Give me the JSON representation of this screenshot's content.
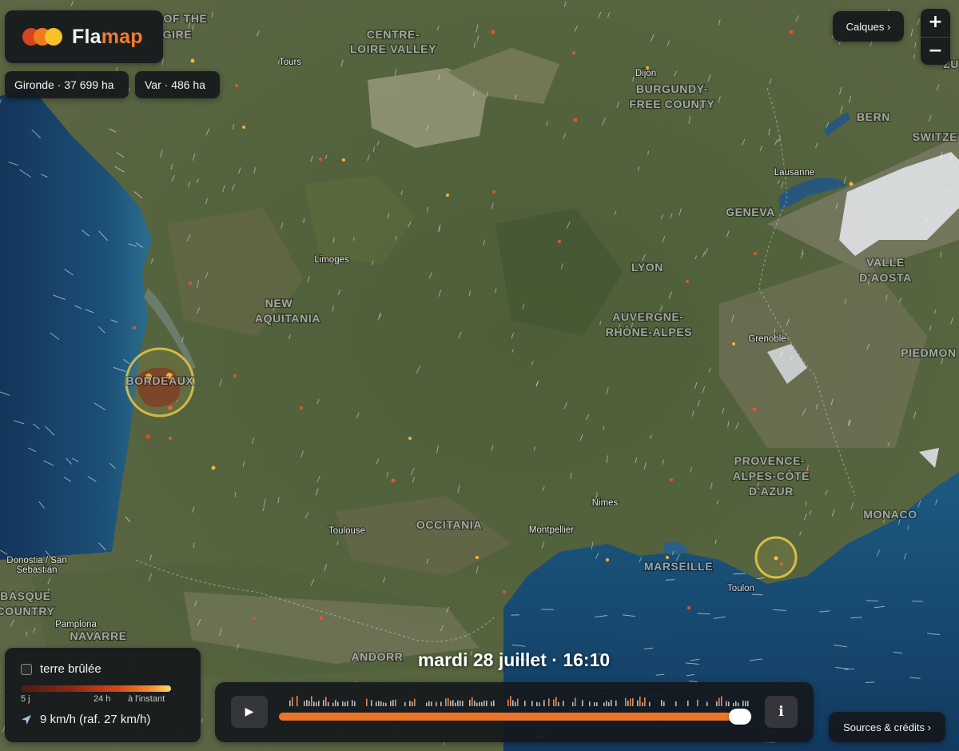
{
  "app": {
    "logo_part1": "Fla",
    "logo_part2": "map"
  },
  "chips": [
    {
      "label": "Gironde · 37 699 ha"
    },
    {
      "label": "Var · 486 ha"
    }
  ],
  "map_labels": [
    {
      "text": "CENTRE-",
      "kind": "region"
    },
    {
      "text": "LOIRE VALLEY",
      "kind": "region"
    },
    {
      "text": "OF THE",
      "kind": "region"
    },
    {
      "text": "GIRE",
      "kind": "region"
    },
    {
      "text": "Tours",
      "kind": "city"
    },
    {
      "text": "Dijon",
      "kind": "city"
    },
    {
      "text": "BURGUNDY-",
      "kind": "region"
    },
    {
      "text": "FREE COUNTY",
      "kind": "region"
    },
    {
      "text": "BERN",
      "kind": "capital"
    },
    {
      "text": "SWITZE",
      "kind": "country"
    },
    {
      "text": "ZU",
      "kind": "capital"
    },
    {
      "text": "Lausanne",
      "kind": "city"
    },
    {
      "text": "GENEVA",
      "kind": "capital"
    },
    {
      "text": "Limoges",
      "kind": "city"
    },
    {
      "text": "LYON",
      "kind": "capital"
    },
    {
      "text": "VALLE",
      "kind": "region"
    },
    {
      "text": "D'AOSTA",
      "kind": "region"
    },
    {
      "text": "NEW",
      "kind": "region"
    },
    {
      "text": "AQUITANIA",
      "kind": "region"
    },
    {
      "text": "AUVERGNE-",
      "kind": "region"
    },
    {
      "text": "RHÔNE-ALPES",
      "kind": "region"
    },
    {
      "text": "Grenoble",
      "kind": "city"
    },
    {
      "text": "PIEDMON",
      "kind": "region"
    },
    {
      "text": "BORDEAUX",
      "kind": "capital"
    },
    {
      "text": "PROVENCE-",
      "kind": "region"
    },
    {
      "text": "ALPES-CÔTE",
      "kind": "region"
    },
    {
      "text": "D'AZUR",
      "kind": "region"
    },
    {
      "text": "Nimes",
      "kind": "city"
    },
    {
      "text": "MONACO",
      "kind": "country"
    },
    {
      "text": "Toulouse",
      "kind": "city"
    },
    {
      "text": "OCCITANIA",
      "kind": "region"
    },
    {
      "text": "Montpellier",
      "kind": "city"
    },
    {
      "text": "Donostia / San",
      "kind": "city"
    },
    {
      "text": "Sebastián",
      "kind": "city"
    },
    {
      "text": "MARSEILLE",
      "kind": "capital"
    },
    {
      "text": "Toulon",
      "kind": "city"
    },
    {
      "text": "BASQUE",
      "kind": "region"
    },
    {
      "text": "COUNTRY",
      "kind": "region"
    },
    {
      "text": "Pamplona",
      "kind": "city"
    },
    {
      "text": "NAVARRE",
      "kind": "region"
    },
    {
      "text": "ANDORR",
      "kind": "country"
    }
  ],
  "controls": {
    "layers_label": "Calques ›",
    "zoom_in": "+",
    "zoom_out": "−",
    "sources_label": "Sources & crédits ›"
  },
  "legend": {
    "burned_label": "terre brûlée",
    "burned_checked": false,
    "ramp_labels": [
      "5 j",
      "24 h",
      "à l'instant"
    ],
    "wind_label": "9 km/h (raf. 27 km/h)"
  },
  "timeline": {
    "date_label": "mardi 28 juillet · 16:10",
    "play_glyph": "▶",
    "info_glyph": "i",
    "progress": 0.975
  },
  "colors": {
    "fire_ring": "#e6c84a",
    "fire_dot": "#f3a23a",
    "accent": "#ed7326",
    "sea": "#16466e",
    "land": "#4a5a3a"
  }
}
